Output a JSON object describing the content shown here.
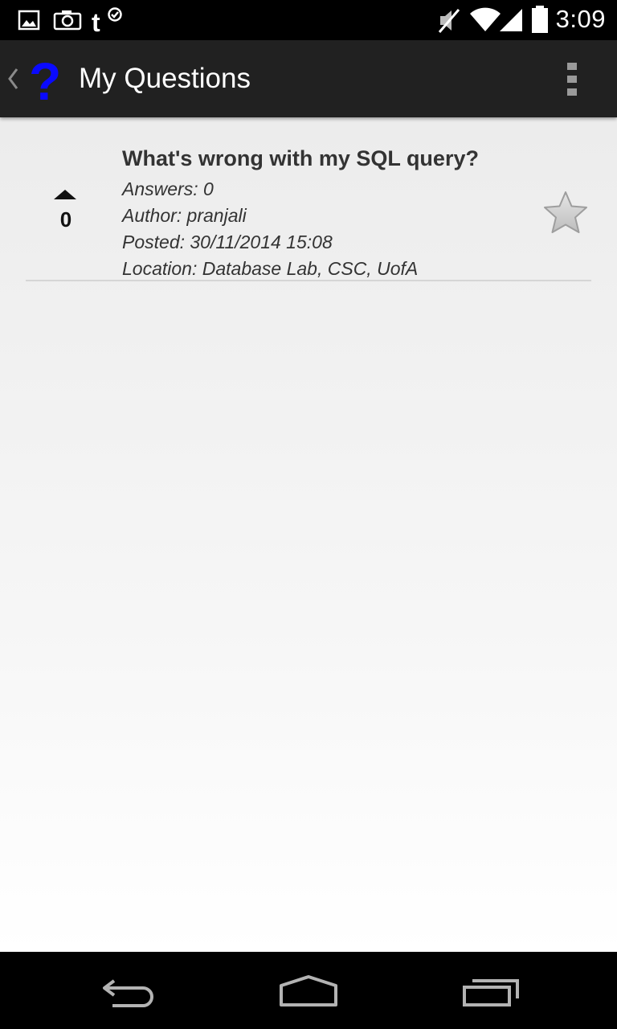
{
  "status_bar": {
    "time": "3:09",
    "icons": [
      "gallery-icon",
      "camera-icon",
      "tumblr-icon",
      "mute-icon",
      "wifi-icon",
      "signal-icon",
      "battery-icon"
    ]
  },
  "action_bar": {
    "title": "My Questions",
    "icons": [
      "up-caret-icon",
      "app-question-icon",
      "overflow-menu-icon"
    ]
  },
  "questions": [
    {
      "votes": "0",
      "title": "What's wrong with my SQL query?",
      "answers": "Answers: 0",
      "author": "Author: pranjali",
      "posted": "Posted: 30/11/2014  15:08",
      "location": "Location: Database Lab, CSC, UofA",
      "favorite_icon": "star-icon"
    }
  ],
  "nav_bar": {
    "icons": [
      "back-icon",
      "home-icon",
      "recents-icon"
    ]
  },
  "colors": {
    "app_icon": "#0a0aff",
    "action_bar": "#212121",
    "background": "#ececec"
  }
}
